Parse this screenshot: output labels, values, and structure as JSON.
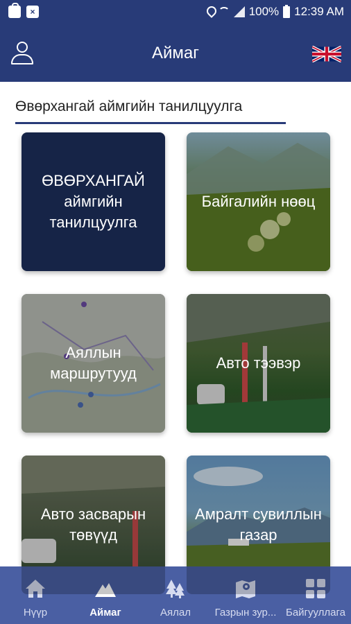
{
  "status_bar": {
    "battery": "100%",
    "time": "12:39 AM",
    "icons": [
      "shopping-bag-icon",
      "close-box-icon",
      "location-pin-icon",
      "wifi-icon",
      "signal-icon",
      "battery-icon"
    ]
  },
  "header": {
    "title": "Аймаг",
    "left_icon": "user-icon",
    "right_icon": "uk-flag-icon"
  },
  "section": {
    "title": "Өвөрхангай аймгийн танилцуулга",
    "rule_color": "#283b78"
  },
  "tiles": [
    {
      "label": "ӨВӨРХАНГАЙ аймгийн танилцуулга"
    },
    {
      "label": "Байгалийн нөөц"
    },
    {
      "label": "Аяллын маршрутууд"
    },
    {
      "label": "Авто тээвэр"
    },
    {
      "label": "Авто засварын төвүүд"
    },
    {
      "label": "Амралт сувиллын газар"
    }
  ],
  "bottom_nav": {
    "items": [
      {
        "label": "Нүүр",
        "icon": "home-icon",
        "active": false
      },
      {
        "label": "Аймаг",
        "icon": "mountain-icon",
        "active": true
      },
      {
        "label": "Аялал",
        "icon": "trees-icon",
        "active": false
      },
      {
        "label": "Газрын зур...",
        "icon": "map-icon",
        "active": false
      },
      {
        "label": "Байгууллага",
        "icon": "grid-icon",
        "active": false
      }
    ]
  },
  "colors": {
    "primary": "#283b78",
    "nav": "#4a5fa3",
    "tile_dark": "#162447"
  }
}
